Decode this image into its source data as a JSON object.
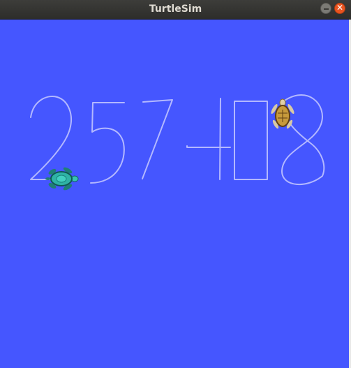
{
  "window": {
    "title": "TurtleSim",
    "minimize_icon": "minimize-icon",
    "close_icon": "close-icon",
    "close_glyph": "✕"
  },
  "canvas": {
    "background": "#4556ff",
    "pen_color": "#b3b8ff",
    "drawn_digits": "257408"
  },
  "turtles": [
    {
      "name": "turtle-green",
      "color": "#2fb3a6",
      "heading_deg": 0
    },
    {
      "name": "turtle-brown",
      "color": "#c79a3c",
      "heading_deg": -90
    }
  ]
}
